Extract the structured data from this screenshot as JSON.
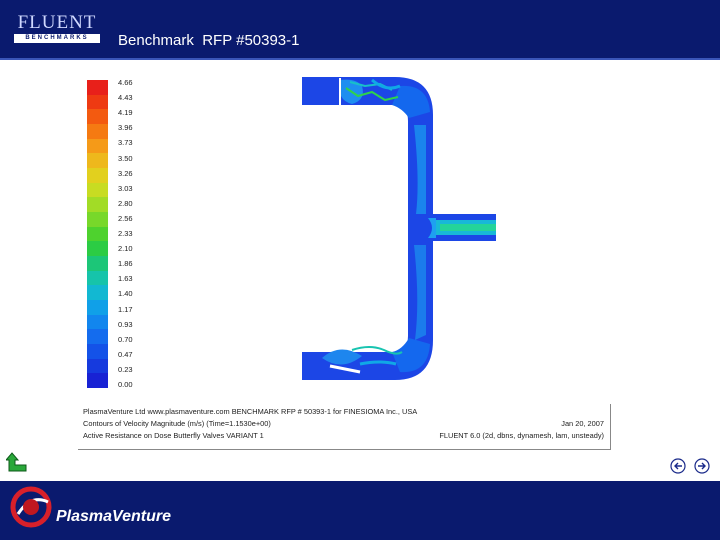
{
  "header": {
    "logo_word": "FLUENT",
    "logo_sub": "BENCHMARKS",
    "title": "Benchmark  RFP #50393-1"
  },
  "legend": {
    "labels": [
      "4.66",
      "4.43",
      "4.19",
      "3.96",
      "3.73",
      "3.50",
      "3.26",
      "3.03",
      "2.80",
      "2.56",
      "2.33",
      "2.10",
      "1.86",
      "1.63",
      "1.40",
      "1.17",
      "0.93",
      "0.70",
      "0.47",
      "0.23",
      "0.00"
    ],
    "colors": [
      "#e8201a",
      "#ee3a12",
      "#f35a10",
      "#f57a12",
      "#f59a18",
      "#eeb81c",
      "#e2d01e",
      "#c8dc22",
      "#a2dc26",
      "#78d82a",
      "#4ed22e",
      "#2ccc44",
      "#1cc678",
      "#16c4aa",
      "#12b8d2",
      "#10a0e8",
      "#1286ee",
      "#146cee",
      "#1452e8",
      "#163ade",
      "#1822d4"
    ]
  },
  "caption": {
    "line1": "PlasmaVenture Ltd  www.plasmaventure.com  BENCHMARK RFP # 50393-1 for  FINESIOMA  Inc., USA",
    "line2": "Contours of Velocity Magnitude (m/s)  (Time=1.1530e+00)",
    "line3": "Active Resistance on Dose Butterfly Valves  VARIANT 1",
    "date": "Jan 20, 2007",
    "solver": "FLUENT 6.0 (2d, dbns, dynamesh, lam, unsteady)"
  },
  "footer": {
    "brand": "PlasmaVenture"
  },
  "colors": {
    "header_bg": "#0a1a6e",
    "footer_bg": "#0a1a6e",
    "pipe_flow": "#1840e6"
  },
  "icons": {
    "back": "back-arrow-icon",
    "prev": "previous-slide-icon",
    "next": "next-slide-icon"
  }
}
